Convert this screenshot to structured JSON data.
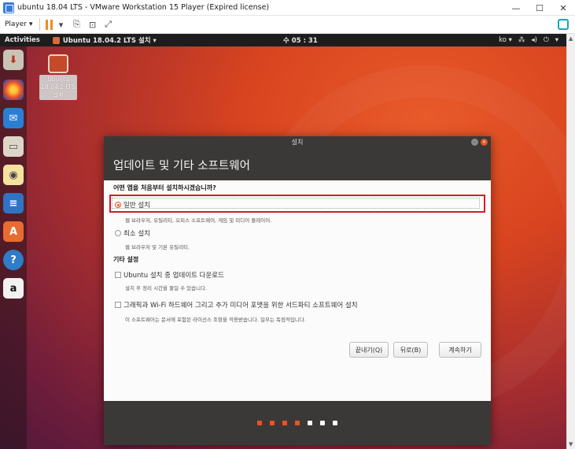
{
  "vmware": {
    "title": "ubuntu 18.04 LTS - VMware Workstation 15 Player (Expired license)",
    "player_menu": "Player",
    "minimize": "—",
    "maximize": "☐",
    "close": "✕"
  },
  "topbar": {
    "activities": "Activities",
    "app_menu": "Ubuntu 18.04.2 LTS 설치 ▾",
    "clock": "수 05 : 31",
    "lang": "ko ▾"
  },
  "desktop_icon": {
    "label": "Ubuntu 18.04.2 LTS 설치"
  },
  "dialog": {
    "window_title": "설치",
    "header": "업데이트 및 기타 소프트웨어",
    "question": "어떤 앱을 처음부터 설치하시겠습니까?",
    "options": [
      {
        "label": "일반 설치",
        "desc": "웹 브라우저, 유틸리티, 오피스 소프트웨어, 게임 및 미디어 플레이어.",
        "selected": true
      },
      {
        "label": "최소 설치",
        "desc": "웹 브라우저 및 기본 유틸리티.",
        "selected": false
      }
    ],
    "other_title": "기타 설정",
    "checks": [
      {
        "label": "Ubuntu 설치 중 업데이트 다운로드",
        "desc": "설치 후 정리 시간을 줄일 수 있습니다.",
        "checked": false
      },
      {
        "label": "그래픽과 Wi-Fi 하드웨어 그리고 추가 미디어 포맷을 위한 서드파티 소프트웨어 설치",
        "desc": "이 소프트웨어는 문서에 포함된 라이선스 조항을 적용받습니다. 일부는 독점적입니다.",
        "checked": false
      }
    ],
    "buttons": {
      "quit": "끝내기(Q)",
      "back": "뒤로(B)",
      "continue": "계속하기"
    },
    "progress": {
      "completed_steps": 4,
      "total_steps": 7
    }
  },
  "colors": {
    "accent": "#e95420",
    "highlight": "#d8192b",
    "dot_done": "#e95420",
    "dot_todo": "#ffffff"
  },
  "icons": {
    "dock": [
      "ubuntu-installer-icon",
      "firefox-icon",
      "thunderbird-icon",
      "files-icon",
      "rhythmbox-icon",
      "writer-icon",
      "software-center-icon",
      "help-icon",
      "amazon-icon"
    ]
  }
}
